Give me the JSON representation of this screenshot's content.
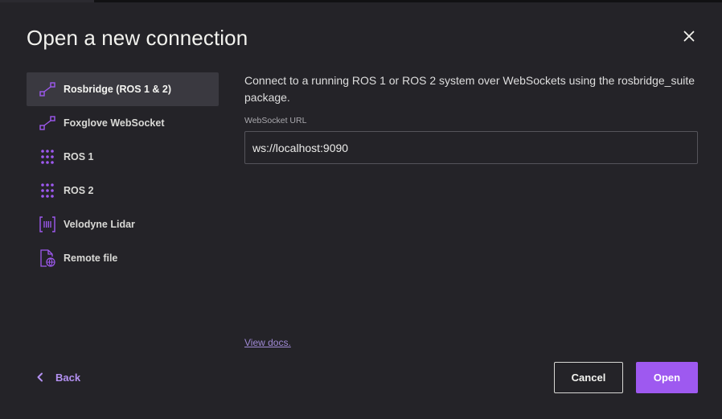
{
  "dialog": {
    "title": "Open a new connection",
    "close_icon": "close-icon"
  },
  "sidebar": {
    "items": [
      {
        "label": "Rosbridge (ROS 1 & 2)",
        "icon": "connection-link-icon",
        "active": true
      },
      {
        "label": "Foxglove WebSocket",
        "icon": "connection-link-icon",
        "active": false
      },
      {
        "label": "ROS 1",
        "icon": "grid-dots-icon",
        "active": false
      },
      {
        "label": "ROS 2",
        "icon": "grid-dots-icon",
        "active": false
      },
      {
        "label": "Velodyne Lidar",
        "icon": "lidar-icon",
        "active": false
      },
      {
        "label": "Remote file",
        "icon": "remote-file-icon",
        "active": false
      }
    ]
  },
  "main": {
    "description": "Connect to a running ROS 1 or ROS 2 system over WebSockets using the rosbridge_suite package.",
    "url_field": {
      "label": "WebSocket URL",
      "value": "ws://localhost:9090"
    },
    "docs_link": "View docs."
  },
  "footer": {
    "back_label": "Back",
    "cancel_label": "Cancel",
    "open_label": "Open"
  },
  "colors": {
    "background": "#242328",
    "accent": "#9e59f0",
    "link": "#a08ad6",
    "sidebar_active": "#3a3940"
  }
}
